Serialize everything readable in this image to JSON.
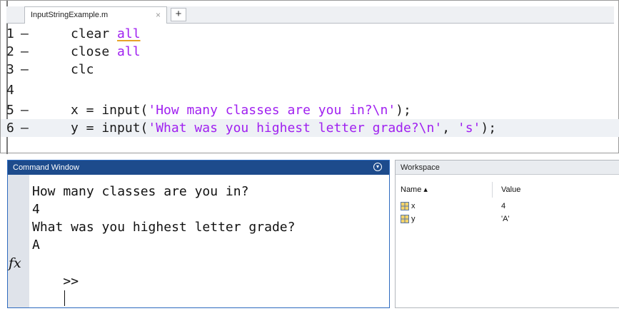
{
  "editor": {
    "tab_title": "InputStringExample.m",
    "tab_close": "×",
    "add_tab": "+",
    "lines": [
      {
        "num": "1",
        "dash": "–",
        "parts": [
          {
            "t": "clear "
          },
          {
            "t": "all",
            "k": "kw"
          }
        ]
      },
      {
        "num": "2",
        "dash": "–",
        "parts": [
          {
            "t": "close "
          },
          {
            "t": "all",
            "k": "kw"
          }
        ]
      },
      {
        "num": "3",
        "dash": "–",
        "parts": [
          {
            "t": "clc"
          }
        ]
      },
      {
        "num": "4",
        "dash": "",
        "parts": []
      },
      {
        "num": "5",
        "dash": "–",
        "parts": [
          {
            "t": "x = input("
          },
          {
            "t": "'How many classes are you in?\\n'",
            "k": "str"
          },
          {
            "t": ");"
          }
        ]
      },
      {
        "num": "6",
        "dash": "–",
        "parts": [
          {
            "t": "y = input("
          },
          {
            "t": "'What was you highest letter grade?\\n'",
            "k": "str"
          },
          {
            "t": ", "
          },
          {
            "t": "'s'",
            "k": "str"
          },
          {
            "t": ");"
          }
        ]
      }
    ]
  },
  "command_window": {
    "title": "Command Window",
    "lines": [
      "How many classes are you in?",
      "4",
      "What was you highest letter grade?",
      "A"
    ],
    "fx_label": "fx",
    "prompt": ">>"
  },
  "workspace": {
    "title": "Workspace",
    "col_name": "Name ▴",
    "col_value": "Value",
    "rows": [
      {
        "name": "x",
        "value": "4",
        "icon": "double-array-icon"
      },
      {
        "name": "y",
        "value": "'A'",
        "icon": "char-array-icon"
      }
    ]
  }
}
